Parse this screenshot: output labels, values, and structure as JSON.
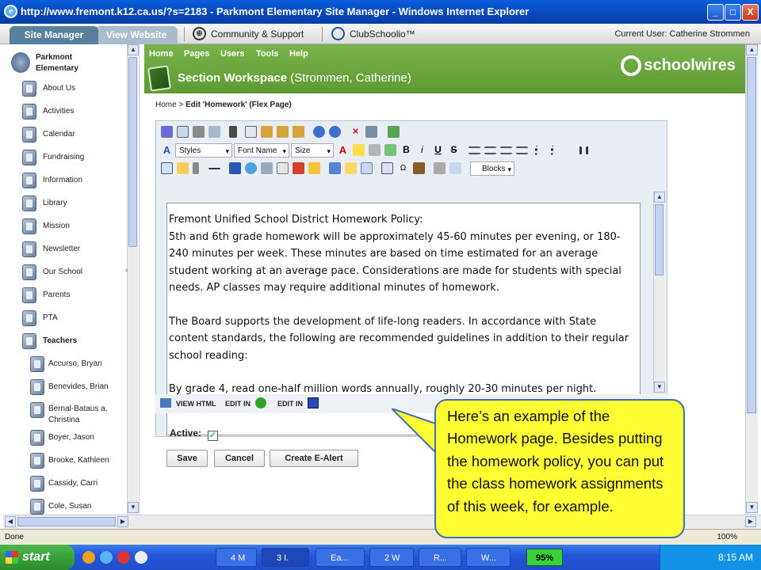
{
  "window": {
    "title": "http://www.fremont.k12.ca.us/?s=2183 - Parkmont Elementary Site Manager - Windows Internet Explorer",
    "min": "_",
    "max": "□",
    "close": "X"
  },
  "topnav": {
    "tab_active": "Site Manager",
    "tab_inactive": "View Website",
    "community": "Community & Support",
    "clubschoolio": "ClubSchoolio™",
    "current_user": "Current User: Catherine Strommen"
  },
  "sidebar": {
    "root": "Parkmont Elementary",
    "items": [
      "About Us",
      "Activities",
      "Calendar",
      "Fundraising",
      "Information",
      "Library",
      "Mission",
      "Newsletter",
      "Our School",
      "Parents",
      "PTA"
    ],
    "teachers_label": "Teachers",
    "teachers": [
      "Accurso, Bryan",
      "Benevides, Brian",
      "Bernal-Bataus a, Christina",
      "Boyer, Jason",
      "Brooke, Kathleen",
      "Cassidy, Carri",
      "Cole, Susan"
    ]
  },
  "menu": [
    "Home",
    "Pages",
    "Users",
    "Tools",
    "Help"
  ],
  "section": {
    "title": "Section Workspace",
    "owner": "(Strommen, Catherine)",
    "brand": "schoolwires"
  },
  "breadcrumb": {
    "home": "Home",
    "sep": " > ",
    "current": "Edit 'Homework' (Flex Page)"
  },
  "toolbar": {
    "styles": "Styles",
    "font_name": "Font Name",
    "size": "Size",
    "blocks": "Blocks",
    "bold": "B",
    "italic": "i",
    "underline": "U",
    "strike": "S"
  },
  "editor": {
    "heading": "Fremont Unified School District Homework Policy:",
    "para1": "5th and 6th grade homework will be approximately 45-60 minutes per evening, or 180-240 minutes per week. These minutes are based on time estimated for an average student working at an average pace.  Considerations are made for students with special needs. AP classes may require additional minutes of homework.",
    "para2": "The Board supports the development of life-long readers. In accordance with State content standards, the following are recommended guidelines in addition to their regular school reading:",
    "para3": "By grade 4, read one-half million words annually, roughly 20-30 minutes per night."
  },
  "editor_tabs": {
    "view_html": "VIEW HTML",
    "edit_in_1": "EDIT IN",
    "edit_in_2": "EDIT IN"
  },
  "form": {
    "active_label": "Active:",
    "active_checked": true,
    "save": "Save",
    "cancel": "Cancel",
    "create_alert": "Create E-Alert"
  },
  "callout": {
    "text": "Here’s an example of the Homework page. Besides putting the homework policy, you can put the class homework assignments of this week, for example."
  },
  "status": {
    "left": "Done",
    "zoom": "100%"
  },
  "taskbar": {
    "start": "start",
    "tasks": [
      "4 M",
      "3 I.",
      "Ea...",
      "2 W",
      "R...",
      "W..."
    ],
    "battery": "95%",
    "clock": "8:15 AM"
  },
  "colors": {
    "green": "#6aa63b",
    "titlebar": "#0a4fc9",
    "callout_fill": "#ffff33",
    "callout_border": "#3f6fb8"
  }
}
